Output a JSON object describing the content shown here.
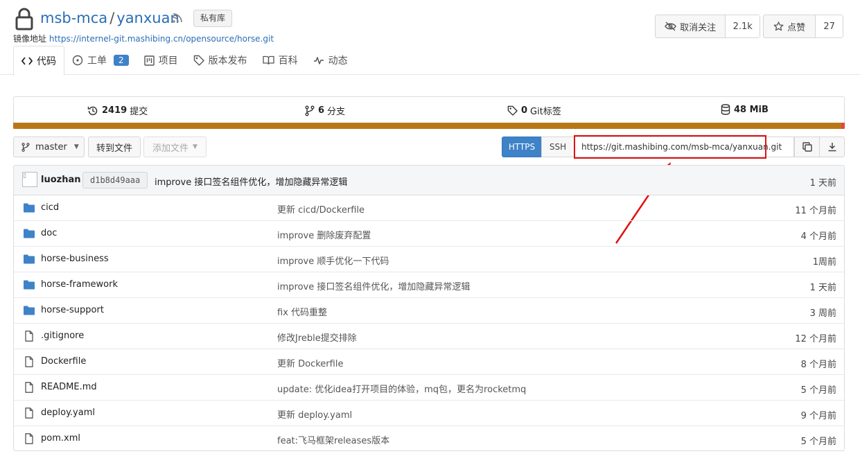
{
  "repo": {
    "owner": "msb-mca",
    "name": "yanxuan",
    "visibility_badge": "私有库",
    "mirror_label": "镜像地址",
    "mirror_url": "https://internel-git.mashibing.cn/opensource/horse.git"
  },
  "actions": {
    "watch_label": "取消关注",
    "watch_count": "2.1k",
    "star_label": "点赞",
    "star_count": "27"
  },
  "tabs": [
    {
      "label": "代码",
      "icon": "code-icon",
      "active": true
    },
    {
      "label": "工单",
      "icon": "issue-icon",
      "badge": "2"
    },
    {
      "label": "项目",
      "icon": "project-icon"
    },
    {
      "label": "版本发布",
      "icon": "tag-icon"
    },
    {
      "label": "百科",
      "icon": "book-icon"
    },
    {
      "label": "动态",
      "icon": "pulse-icon"
    }
  ],
  "stats": {
    "commits_count": "2419",
    "commits_label": "提交",
    "branches_count": "6",
    "branches_label": "分支",
    "tags_count": "0",
    "tags_label": "Git标签",
    "size_value": "48 MiB"
  },
  "toolbar": {
    "branch": "master",
    "goto_file": "转到文件",
    "add_file": "添加文件",
    "https_label": "HTTPS",
    "ssh_label": "SSH",
    "clone_url": "https://git.mashibing.com/msb-mca/yanxuan.git"
  },
  "latest_commit": {
    "author": "luozhan",
    "sha": "d1b8d49aaa",
    "message": "improve 接口签名组件优化，增加隐藏异常逻辑",
    "time": "1 天前"
  },
  "files": [
    {
      "type": "folder",
      "name": "cicd",
      "message": "更新 cicd/Dockerfile",
      "time": "11 个月前"
    },
    {
      "type": "folder",
      "name": "doc",
      "message": "improve 删除废弃配置",
      "time": "4 个月前"
    },
    {
      "type": "folder",
      "name": "horse-business",
      "message": "improve 顺手优化一下代码",
      "time": "1周前"
    },
    {
      "type": "folder",
      "name": "horse-framework",
      "message": "improve 接口签名组件优化，增加隐藏异常逻辑",
      "time": "1 天前"
    },
    {
      "type": "folder",
      "name": "horse-support",
      "message": "fix 代码重整",
      "time": "3 周前"
    },
    {
      "type": "file",
      "name": ".gitignore",
      "message": "修改Jreble提交排除",
      "time": "12 个月前"
    },
    {
      "type": "file",
      "name": "Dockerfile",
      "message": "更新 Dockerfile",
      "time": "8 个月前"
    },
    {
      "type": "file",
      "name": "README.md",
      "message": "update: 优化idea打开项目的体验，mq包，更名为rocketmq",
      "time": "5 个月前"
    },
    {
      "type": "file",
      "name": "deploy.yaml",
      "message": "更新 deploy.yaml",
      "time": "9 个月前"
    },
    {
      "type": "file",
      "name": "pom.xml",
      "message": "feat:飞马框架releases版本",
      "time": "5 个月前"
    }
  ],
  "colors": {
    "link": "#2a6eb6",
    "primary": "#3e82c8",
    "language_bar": "#b87717",
    "annotation": "#e01010"
  }
}
